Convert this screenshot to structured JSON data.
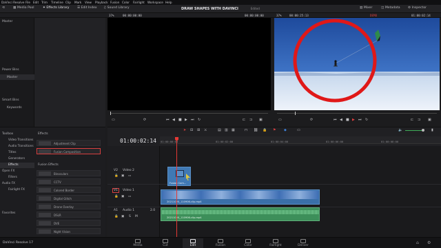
{
  "menubar": {
    "items": [
      "DaVinci Resolve",
      "File",
      "Edit",
      "Trim",
      "Timeline",
      "Clip",
      "Mark",
      "View",
      "Playback",
      "Fusion",
      "Color",
      "Fairlight",
      "Workspace",
      "Help"
    ]
  },
  "toolbar": {
    "media_pool": "Media Pool",
    "effects_library": "Effects Library",
    "edit_index": "Edit Index",
    "sound_library": "Sound Library",
    "project_title": "DRAW SHAPES WITH DAVINCI",
    "edited": "Edited",
    "mixer": "Mixer",
    "metadata": "Metadata",
    "inspector": "Inspector"
  },
  "bar2": {
    "source_zoom": "37%",
    "source_tc_left": "00:00:00:00",
    "source_tc_right": "00:00:00:00",
    "timeline_zoom": "37%",
    "timeline_tc_left": "00:00:25:13",
    "timeline_name": "DEMO",
    "timeline_tc_right": "01:00:02:14"
  },
  "mediapool": {
    "master": "Master",
    "power_bins": "Power Bins",
    "power_master": "Master",
    "smart_bins": "Smart Bins",
    "keywords": "Keywords"
  },
  "fx_tree": {
    "toolbox": "Toolbox",
    "video_transitions": "Video Transitions",
    "audio_transitions": "Audio Transitions",
    "titles": "Titles",
    "generators": "Generators",
    "effects": "Effects",
    "openfx": "Open FX",
    "filters": "Filters",
    "audiofx": "Audio FX",
    "fairlightfx": "Fairlight FX",
    "favorites": "Favorites"
  },
  "fx_list": {
    "effects_header": "Effects",
    "adjustment_clip": "Adjustment Clip",
    "fusion_composition": "Fusion Composition",
    "fusion_effects_header": "Fusion Effects",
    "items": [
      "Binoculars",
      "CCTV",
      "Colored Border",
      "Digital Glitch",
      "Drone Overlay",
      "DSLR",
      "DVE",
      "Night Vision"
    ]
  },
  "timeline": {
    "timecode": "01:00:02:14",
    "ticks": [
      "01:00:00:00",
      "01:00:02:00",
      "01:00:04:00",
      "01:00:06:00",
      "01:00:08:00"
    ],
    "tracks": {
      "v2": {
        "id": "V2",
        "name": "Video 2"
      },
      "v1": {
        "id": "V1",
        "name": "Video 1"
      },
      "a1": {
        "id": "A1",
        "name": "Audio 1",
        "level": "2.0"
      }
    },
    "fusion_clip_label": "Fusion Com...",
    "video_clip_label": "20211020_110906-clip.mp4",
    "audio_clip_label": "20211020_110906-clip.mp4"
  },
  "pagebar": {
    "app_name": "DaVinci Resolve 17",
    "tabs": [
      "Media",
      "Cut",
      "Edit",
      "Fusion",
      "Color",
      "Fairlight",
      "Deliver"
    ],
    "active_tab": "Edit"
  },
  "colors": {
    "playhead": "#e53935",
    "selection_border": "#d94040",
    "video_clip": "#3a6fa8",
    "audio_clip": "#3d8f5a",
    "circle": "#e01818"
  }
}
